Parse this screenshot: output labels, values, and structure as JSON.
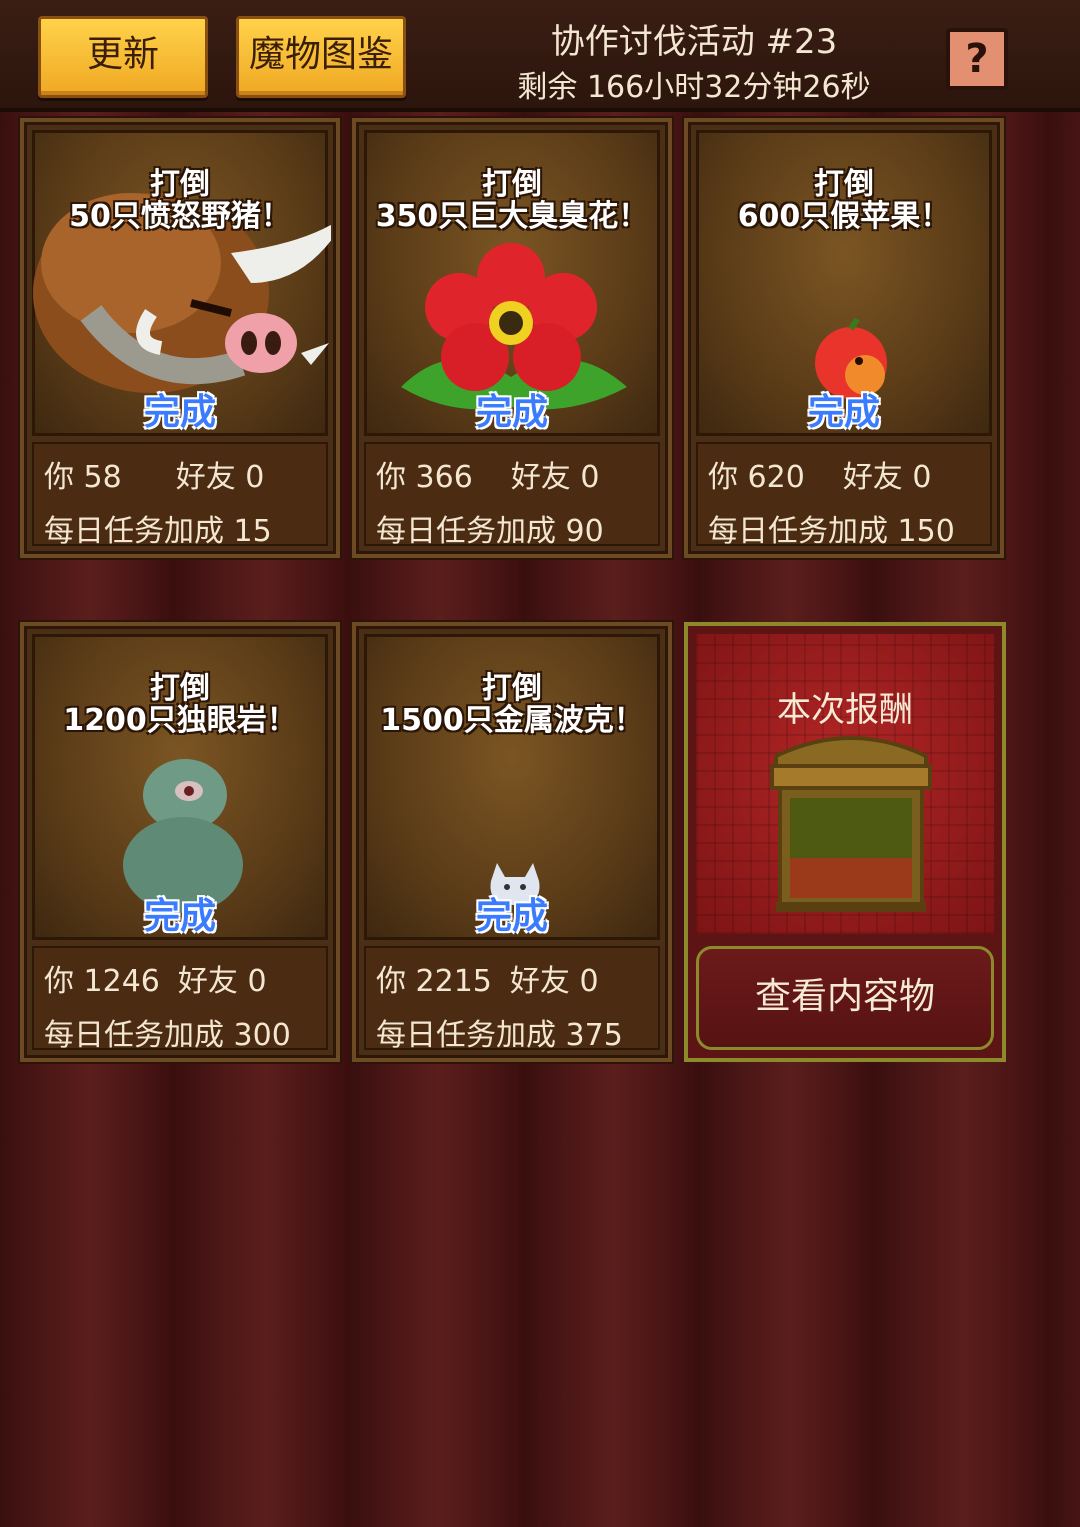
{
  "header": {
    "update_label": "更新",
    "dex_label": "魔物图鉴",
    "event_title": "协作讨伐活动 #23",
    "timer": "剩余 166小时32分钟26秒",
    "help_label": "?"
  },
  "labels": {
    "you": "你",
    "friend": "好友",
    "bonus": "每日任务加成",
    "done": "完成"
  },
  "quests": [
    {
      "title1": "打倒",
      "title2": "50只愤怒野猪！",
      "you": "58",
      "friend": "0",
      "bonus": "15",
      "monster": "angry-boar"
    },
    {
      "title1": "打倒",
      "title2": "350只巨大臭臭花！",
      "you": "366",
      "friend": "0",
      "bonus": "90",
      "monster": "giant-stinky-flower"
    },
    {
      "title1": "打倒",
      "title2": "600只假苹果！",
      "you": "620",
      "friend": "0",
      "bonus": "150",
      "monster": "fake-apple"
    },
    {
      "title1": "打倒",
      "title2": "1200只独眼岩！",
      "you": "1246",
      "friend": "0",
      "bonus": "300",
      "monster": "one-eyed-rock"
    },
    {
      "title1": "打倒",
      "title2": "1500只金属波克！",
      "you": "2215",
      "friend": "0",
      "bonus": "375",
      "monster": "metal-boke"
    }
  ],
  "reward": {
    "title": "本次报酬",
    "view_label": "查看内容物",
    "icon": "treasure-chest"
  },
  "colors": {
    "done_text": "#3b7cff",
    "button_yellow": "#f0a823",
    "reward_border": "#8c8a2a"
  }
}
